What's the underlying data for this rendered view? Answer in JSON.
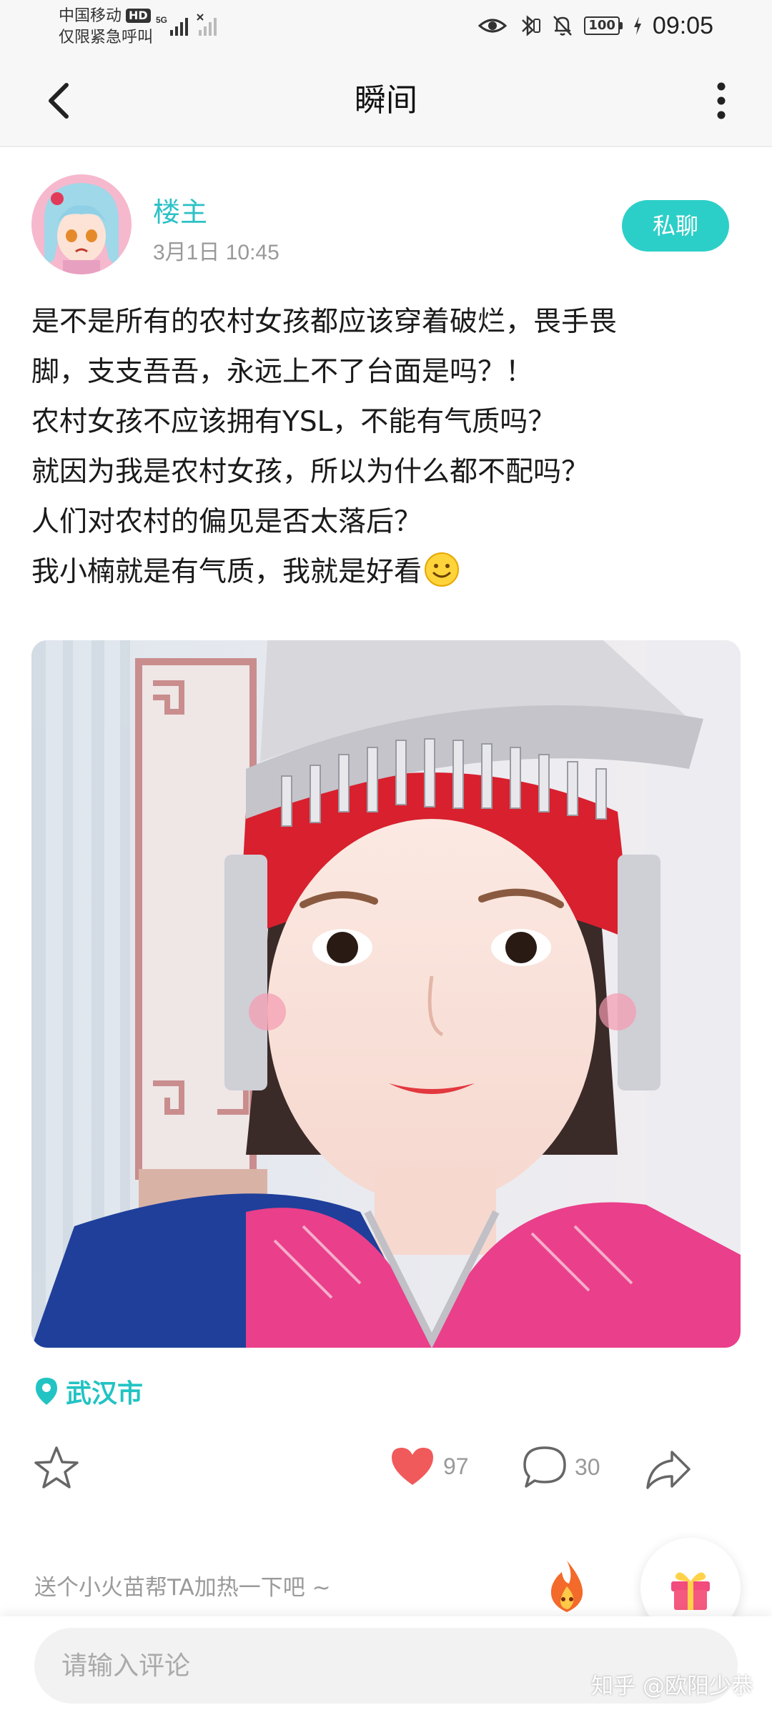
{
  "status_bar": {
    "carrier": "中国移动",
    "carrier_badge": "HD",
    "emergency": "仅限紧急呼叫",
    "network": "5G",
    "battery": "100",
    "time": "09:05"
  },
  "nav": {
    "title": "瞬间",
    "back_icon": "chevron-left-icon",
    "more_icon": "vertical-dots-icon"
  },
  "post": {
    "author": "楼主",
    "time": "3月1日 10:45",
    "pm_label": "私聊",
    "lines": [
      "是不是所有的农村女孩都应该穿着破烂，畏手畏",
      "脚，支支吾吾，永远上不了台面是吗？！",
      "农村女孩不应该拥有YSL，不能有气质吗？",
      "就因为我是农村女孩，所以为什么都不配吗？",
      "人们对农村的偏见是否太落后？",
      "我小楠就是有气质，我就是好看"
    ],
    "location": "武汉市"
  },
  "actions": {
    "likes": "97",
    "comments": "30"
  },
  "boost": {
    "text": "送个小火苗帮TA加热一下吧 ~"
  },
  "comment_bar": {
    "placeholder": "请输入评论"
  },
  "watermark": "知乎 @欧阳少恭",
  "colors": {
    "accent": "#2ccfc8",
    "like": "#f05a5a",
    "text_muted": "#999999"
  }
}
